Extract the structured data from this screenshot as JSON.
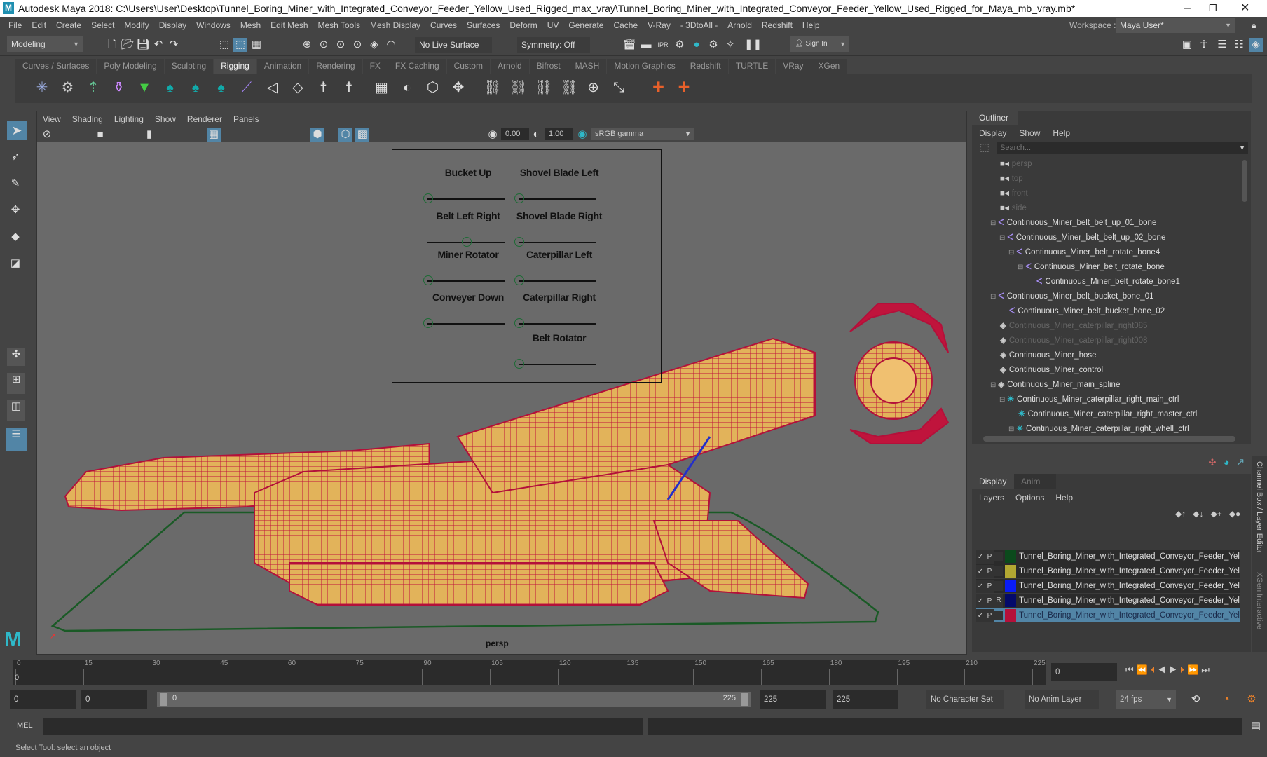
{
  "window": {
    "title": "Autodesk Maya 2018: C:\\Users\\User\\Desktop\\Tunnel_Boring_Miner_with_Integrated_Conveyor_Feeder_Yellow_Used_Rigged_max_vray\\Tunnel_Boring_Miner_with_Integrated_Conveyor_Feeder_Yellow_Used_Rigged_for_Maya_mb_vray.mb*",
    "logo": "M"
  },
  "menu": [
    "File",
    "Edit",
    "Create",
    "Select",
    "Modify",
    "Display",
    "Windows",
    "Mesh",
    "Edit Mesh",
    "Mesh Tools",
    "Mesh Display",
    "Curves",
    "Surfaces",
    "Deform",
    "UV",
    "Generate",
    "Cache",
    "V-Ray",
    "- 3DtoAll -",
    "Arnold",
    "Redshift",
    "Help"
  ],
  "workspace": {
    "label": "Workspace :",
    "value": "Maya User*"
  },
  "toolbar": {
    "mode": "Modeling",
    "live_surface": "No Live Surface",
    "symmetry": "Symmetry: Off",
    "sign_in": "Sign In"
  },
  "shelf_tabs": [
    "Curves / Surfaces",
    "Poly Modeling",
    "Sculpting",
    "Rigging",
    "Animation",
    "Rendering",
    "FX",
    "FX Caching",
    "Custom",
    "Arnold",
    "Bifrost",
    "MASH",
    "Motion Graphics",
    "Redshift",
    "TURTLE",
    "VRay",
    "XGen"
  ],
  "shelf_active": "Rigging",
  "panel_menu": [
    "View",
    "Shading",
    "Lighting",
    "Show",
    "Renderer",
    "Panels"
  ],
  "panel_toolbar": {
    "exposure": "0.00",
    "gamma": "1.00",
    "color_space": "sRGB gamma"
  },
  "viewport": {
    "camera_label": "persp"
  },
  "controls": [
    {
      "label": "Bucket Up",
      "value": 0
    },
    {
      "label": "Shovel Blade Left",
      "value": 0
    },
    {
      "label": "Belt Left Right",
      "value": 0.5
    },
    {
      "label": "Shovel Blade Right",
      "value": 0
    },
    {
      "label": "Miner Rotator",
      "value": 0
    },
    {
      "label": "Caterpillar Left",
      "value": 0
    },
    {
      "label": "Conveyer Down",
      "value": 0
    },
    {
      "label": "Caterpillar Right",
      "value": 0
    },
    {
      "label": "Belt Rotator",
      "value": 0
    }
  ],
  "outliner": {
    "title": "Outliner",
    "menu": [
      "Display",
      "Show",
      "Help"
    ],
    "search_placeholder": "Search...",
    "items": [
      {
        "name": "persp",
        "icon": "camera",
        "depth": 0,
        "dim": true
      },
      {
        "name": "top",
        "icon": "camera",
        "depth": 0,
        "dim": true
      },
      {
        "name": "front",
        "icon": "camera",
        "depth": 0,
        "dim": true
      },
      {
        "name": "side",
        "icon": "camera",
        "depth": 0,
        "dim": true
      },
      {
        "name": "Continuous_Miner_belt_belt_up_01_bone",
        "icon": "joint",
        "depth": 0,
        "expand": true
      },
      {
        "name": "Continuous_Miner_belt_belt_up_02_bone",
        "icon": "joint",
        "depth": 1,
        "expand": true
      },
      {
        "name": "Continuous_Miner_belt_rotate_bone4",
        "icon": "joint",
        "depth": 2,
        "expand": true
      },
      {
        "name": "Continuous_Miner_belt_rotate_bone",
        "icon": "joint",
        "depth": 3,
        "expand": true
      },
      {
        "name": "Continuous_Miner_belt_rotate_bone1",
        "icon": "joint",
        "depth": 4
      },
      {
        "name": "Continuous_Miner_belt_bucket_bone_01",
        "icon": "joint",
        "depth": 0,
        "expand": true
      },
      {
        "name": "Continuous_Miner_belt_bucket_bone_02",
        "icon": "joint",
        "depth": 1
      },
      {
        "name": "Continuous_Miner_caterpillar_right085",
        "icon": "mesh",
        "depth": 0,
        "dim": true
      },
      {
        "name": "Continuous_Miner_caterpillar_right008",
        "icon": "mesh",
        "depth": 0,
        "dim": true
      },
      {
        "name": "Continuous_Miner_hose",
        "icon": "mesh",
        "depth": 0
      },
      {
        "name": "Continuous_Miner_control",
        "icon": "mesh",
        "depth": 0
      },
      {
        "name": "Continuous_Miner_main_spline",
        "icon": "mesh",
        "depth": 0,
        "expand": true
      },
      {
        "name": "Continuous_Miner_caterpillar_right_main_ctrl",
        "icon": "ctrl",
        "depth": 1,
        "expand": true
      },
      {
        "name": "Continuous_Miner_caterpillar_right_master_ctrl",
        "icon": "ctrl",
        "depth": 2
      },
      {
        "name": "Continuous_Miner_caterpillar_right_whell_ctrl",
        "icon": "ctrl",
        "depth": 2,
        "expand": true
      }
    ]
  },
  "layer_editor": {
    "tabs": [
      "Display",
      "Anim"
    ],
    "menu": [
      "Layers",
      "Options",
      "Help"
    ],
    "layers": [
      {
        "v": "✓",
        "p": "P",
        "r": "",
        "color": "#0b4a1c",
        "name": "Tunnel_Boring_Miner_with_Integrated_Conveyor_Feeder_Yellow"
      },
      {
        "v": "✓",
        "p": "P",
        "r": "",
        "color": "#b3a832",
        "name": "Tunnel_Boring_Miner_with_Integrated_Conveyor_Feeder_Yellow"
      },
      {
        "v": "✓",
        "p": "P",
        "r": "",
        "color": "#0a1cf5",
        "name": "Tunnel_Boring_Miner_with_Integrated_Conveyor_Feeder_Yellow"
      },
      {
        "v": "✓",
        "p": "P",
        "r": "R",
        "color": "#040a6b",
        "name": "Tunnel_Boring_Miner_with_Integrated_Conveyor_Feeder_Yellow"
      },
      {
        "v": "✓",
        "p": "P",
        "r": "",
        "color": "#b5103a",
        "name": "Tunnel_Boring_Miner_with_Integrated_Conveyor_Feeder_Yellow",
        "selected": true
      }
    ]
  },
  "side_tabs": [
    "Channel Box / Layer Editor",
    "XGen Interactive"
  ],
  "timeline": {
    "ticks": [
      0,
      15,
      30,
      45,
      60,
      75,
      90,
      105,
      120,
      135,
      150,
      165,
      180,
      195,
      210,
      225
    ],
    "current_frame": "0",
    "current_frame_field": "0"
  },
  "range": {
    "start": "0",
    "anim_start": "0",
    "slider_start": "0",
    "slider_end": "225",
    "end": "225",
    "anim_end": "225",
    "character_set": "No Character Set",
    "anim_layer": "No Anim Layer",
    "fps": "24 fps"
  },
  "mel": {
    "label": "MEL"
  },
  "status": "Select Tool: select an object",
  "colors": {
    "accent": "#5285a6",
    "mesh_fill": "#e8b85a",
    "wire": "#c0143c",
    "ctrl": "#1d6b35"
  }
}
